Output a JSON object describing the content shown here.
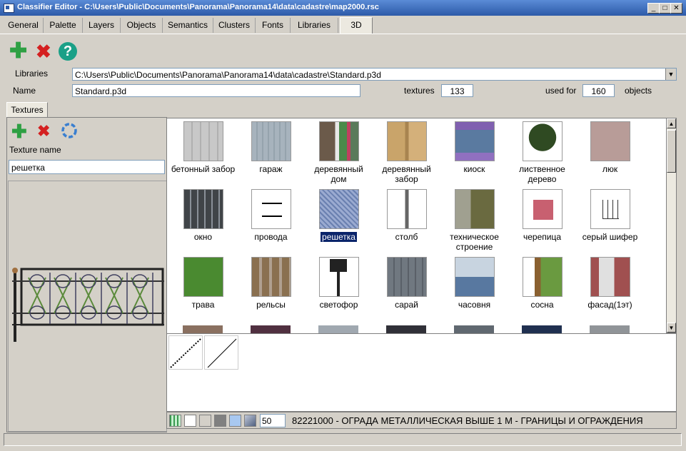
{
  "window": {
    "title": "Classifier Editor - C:\\Users\\Public\\Documents\\Panorama\\Panorama14\\data\\cadastre\\map2000.rsc"
  },
  "tabs": [
    "General",
    "Palette",
    "Layers",
    "Objects",
    "Semantics",
    "Clusters",
    "Fonts",
    "Libraries",
    "3D"
  ],
  "active_tab": "3D",
  "form": {
    "libraries_label": "Libraries",
    "libraries_value": "C:\\Users\\Public\\Documents\\Panorama\\Panorama14\\data\\cadastre\\Standard.p3d",
    "name_label": "Name",
    "name_value": "Standard.p3d",
    "textures_label": "textures",
    "textures_count": "133",
    "used_for_label": "used for",
    "used_for_count": "160",
    "objects_label": "objects"
  },
  "textures_tab": "Textures",
  "left": {
    "texture_name_label": "Texture name",
    "texture_name_value": "решетка"
  },
  "textures": [
    "бетонный забор",
    "гараж",
    "деревянный дом",
    "деревянный забор",
    "киоск",
    "лиственное дерево",
    "люк",
    "окно",
    "провода",
    "решетка",
    "столб",
    "техническое строение",
    "черепица",
    "серый шифер",
    "трава",
    "рельсы",
    "светофор",
    "сарай",
    "часовня",
    "сосна",
    "фасад(1эт)"
  ],
  "selected_texture": "решетка",
  "status": {
    "zoom": "50",
    "object_info": "82221000 - ОГРАДА МЕТАЛЛИЧЕСКАЯ ВЫШЕ 1 М - ГРАНИЦЫ И ОГРАЖДЕНИЯ"
  },
  "colors": {
    "accent": "#0a246a",
    "add": "#2ea043",
    "delete": "#d42020",
    "help": "#1aa087"
  }
}
